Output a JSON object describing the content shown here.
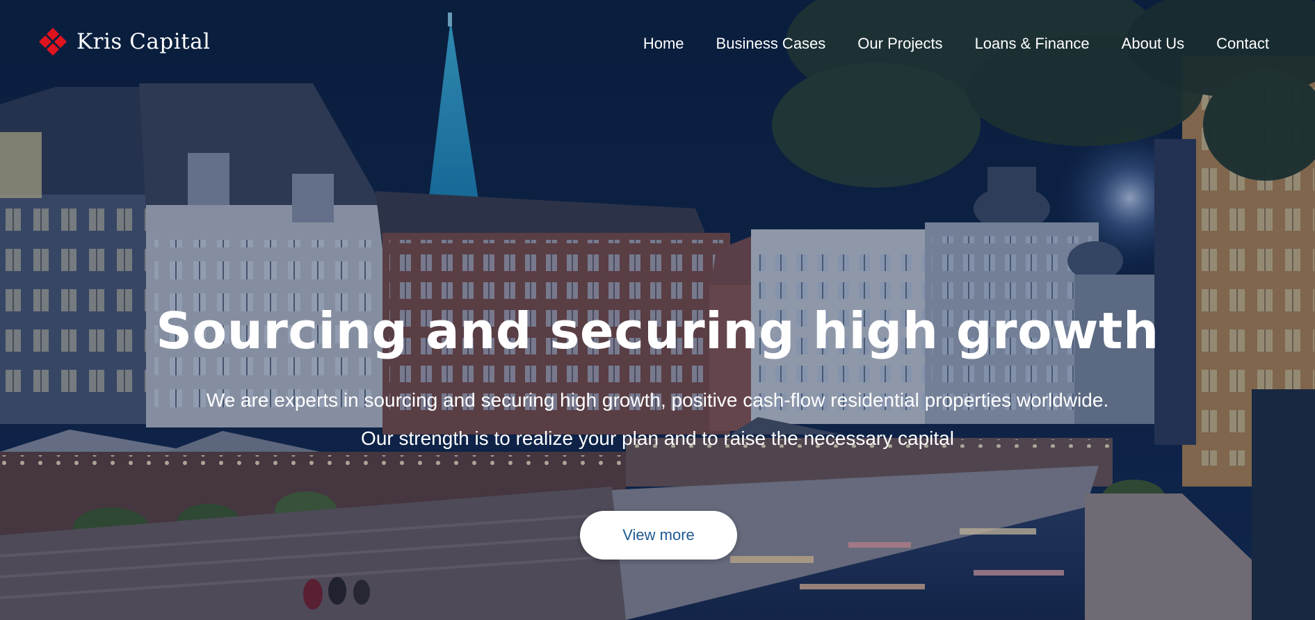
{
  "brand": {
    "name": "Kris Capital",
    "logo_icon": "red-diamond-cluster-icon",
    "accent_color": "#e0141e"
  },
  "nav": {
    "items": [
      {
        "label": "Home"
      },
      {
        "label": "Business Cases"
      },
      {
        "label": "Our Projects"
      },
      {
        "label": "Loans & Finance"
      },
      {
        "label": "About Us"
      },
      {
        "label": "Contact"
      }
    ]
  },
  "hero": {
    "title": "Sourcing and securing high growth",
    "subtitle": "We are experts in sourcing and securing high growth, positive cash-flow residential properties worldwide. Our strength is to realize your plan and to raise the necessary capital",
    "cta_label": "View more",
    "cta_text_color": "#1f5a92"
  },
  "background": {
    "overlay_color": "#0c2146"
  }
}
